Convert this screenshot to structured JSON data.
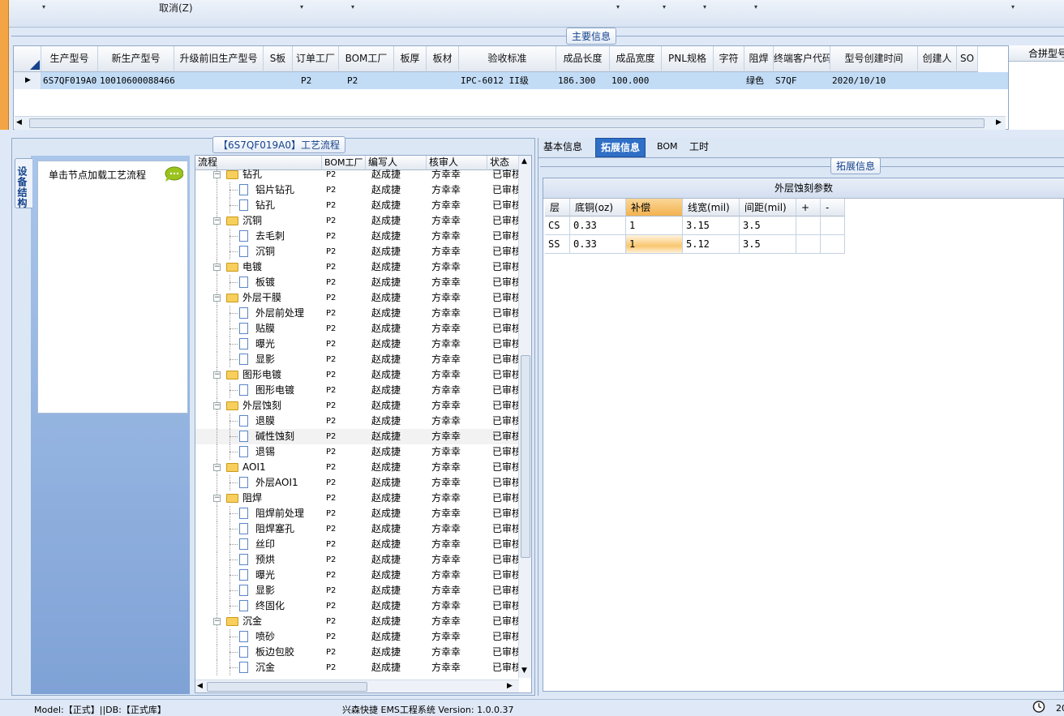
{
  "toolbar": {
    "cancel_label": "取消(Z)",
    "dropdown_glyph": "▾"
  },
  "main_group": {
    "title": "主要信息",
    "columns": [
      "生产型号",
      "新生产型号",
      "升级前旧生产型号",
      "S板",
      "订单工厂",
      "BOM工厂",
      "板厚",
      "板材",
      "验收标准",
      "成品长度",
      "成品宽度",
      "PNL规格",
      "字符",
      "阻焊",
      "终端客户代码",
      "型号创建时间",
      "创建人",
      "SO"
    ],
    "row": {
      "indicator": "▶",
      "cells": [
        "6S7QF019A0",
        "10010600088466",
        "",
        "",
        "P2",
        "P2",
        "",
        "",
        "IPC-6012 II级",
        "186.300",
        "100.000",
        "",
        "",
        "绿色",
        "S7QF",
        "2020/10/10",
        "",
        ""
      ]
    },
    "merge_panel_title": "合拼型号"
  },
  "process_group": {
    "title": "【6S7QF019A0】工艺流程"
  },
  "side_tab": {
    "label": "设备结构"
  },
  "hint_text": "单击节点加载工艺流程",
  "tree": {
    "headers": [
      "流程",
      "BOM工厂",
      "编写人",
      "核审人",
      "状态"
    ],
    "rows": [
      {
        "name": "钻孔",
        "type": "folder",
        "bom": "P2",
        "writer": "赵成捷",
        "reviewer": "方幸幸",
        "status": "已审核"
      },
      {
        "name": "铝片钻孔",
        "type": "doc",
        "bom": "P2",
        "writer": "赵成捷",
        "reviewer": "方幸幸",
        "status": "已审核"
      },
      {
        "name": "钻孔",
        "type": "doc",
        "bom": "P2",
        "writer": "赵成捷",
        "reviewer": "方幸幸",
        "status": "已审核"
      },
      {
        "name": "沉铜",
        "type": "folder",
        "bom": "P2",
        "writer": "赵成捷",
        "reviewer": "方幸幸",
        "status": "已审核"
      },
      {
        "name": "去毛刺",
        "type": "doc",
        "bom": "P2",
        "writer": "赵成捷",
        "reviewer": "方幸幸",
        "status": "已审核"
      },
      {
        "name": "沉铜",
        "type": "doc",
        "bom": "P2",
        "writer": "赵成捷",
        "reviewer": "方幸幸",
        "status": "已审核"
      },
      {
        "name": "电镀",
        "type": "folder",
        "bom": "P2",
        "writer": "赵成捷",
        "reviewer": "方幸幸",
        "status": "已审核"
      },
      {
        "name": "板镀",
        "type": "doc",
        "bom": "P2",
        "writer": "赵成捷",
        "reviewer": "方幸幸",
        "status": "已审核"
      },
      {
        "name": "外层干膜",
        "type": "folder",
        "bom": "P2",
        "writer": "赵成捷",
        "reviewer": "方幸幸",
        "status": "已审核"
      },
      {
        "name": "外层前处理",
        "type": "doc",
        "bom": "P2",
        "writer": "赵成捷",
        "reviewer": "方幸幸",
        "status": "已审核"
      },
      {
        "name": "贴膜",
        "type": "doc",
        "bom": "P2",
        "writer": "赵成捷",
        "reviewer": "方幸幸",
        "status": "已审核"
      },
      {
        "name": "曝光",
        "type": "doc",
        "bom": "P2",
        "writer": "赵成捷",
        "reviewer": "方幸幸",
        "status": "已审核"
      },
      {
        "name": "显影",
        "type": "doc",
        "bom": "P2",
        "writer": "赵成捷",
        "reviewer": "方幸幸",
        "status": "已审核"
      },
      {
        "name": "图形电镀",
        "type": "folder",
        "bom": "P2",
        "writer": "赵成捷",
        "reviewer": "方幸幸",
        "status": "已审核"
      },
      {
        "name": "图形电镀",
        "type": "doc",
        "bom": "P2",
        "writer": "赵成捷",
        "reviewer": "方幸幸",
        "status": "已审核"
      },
      {
        "name": "外层蚀刻",
        "type": "folder",
        "bom": "P2",
        "writer": "赵成捷",
        "reviewer": "方幸幸",
        "status": "已审核"
      },
      {
        "name": "退膜",
        "type": "doc",
        "bom": "P2",
        "writer": "赵成捷",
        "reviewer": "方幸幸",
        "status": "已审核"
      },
      {
        "name": "碱性蚀刻",
        "type": "doc",
        "bom": "P2",
        "writer": "赵成捷",
        "reviewer": "方幸幸",
        "status": "已审核",
        "selected": true
      },
      {
        "name": "退锡",
        "type": "doc",
        "bom": "P2",
        "writer": "赵成捷",
        "reviewer": "方幸幸",
        "status": "已审核"
      },
      {
        "name": "AOI1",
        "type": "folder",
        "bom": "P2",
        "writer": "赵成捷",
        "reviewer": "方幸幸",
        "status": "已审核"
      },
      {
        "name": "外层AOI1",
        "type": "doc",
        "bom": "P2",
        "writer": "赵成捷",
        "reviewer": "方幸幸",
        "status": "已审核"
      },
      {
        "name": "阻焊",
        "type": "folder",
        "bom": "P2",
        "writer": "赵成捷",
        "reviewer": "方幸幸",
        "status": "已审核"
      },
      {
        "name": "阻焊前处理",
        "type": "doc",
        "bom": "P2",
        "writer": "赵成捷",
        "reviewer": "方幸幸",
        "status": "已审核"
      },
      {
        "name": "阻焊塞孔",
        "type": "doc",
        "bom": "P2",
        "writer": "赵成捷",
        "reviewer": "方幸幸",
        "status": "已审核"
      },
      {
        "name": "丝印",
        "type": "doc",
        "bom": "P2",
        "writer": "赵成捷",
        "reviewer": "方幸幸",
        "status": "已审核"
      },
      {
        "name": "预烘",
        "type": "doc",
        "bom": "P2",
        "writer": "赵成捷",
        "reviewer": "方幸幸",
        "status": "已审核"
      },
      {
        "name": "曝光",
        "type": "doc",
        "bom": "P2",
        "writer": "赵成捷",
        "reviewer": "方幸幸",
        "status": "已审核"
      },
      {
        "name": "显影",
        "type": "doc",
        "bom": "P2",
        "writer": "赵成捷",
        "reviewer": "方幸幸",
        "status": "已审核"
      },
      {
        "name": "终固化",
        "type": "doc",
        "bom": "P2",
        "writer": "赵成捷",
        "reviewer": "方幸幸",
        "status": "已审核"
      },
      {
        "name": "沉金",
        "type": "folder",
        "bom": "P2",
        "writer": "赵成捷",
        "reviewer": "方幸幸",
        "status": "已审核"
      },
      {
        "name": "喷砂",
        "type": "doc",
        "bom": "P2",
        "writer": "赵成捷",
        "reviewer": "方幸幸",
        "status": "已审核"
      },
      {
        "name": "板边包胶",
        "type": "doc",
        "bom": "P2",
        "writer": "赵成捷",
        "reviewer": "方幸幸",
        "status": "已审核"
      },
      {
        "name": "沉金",
        "type": "doc",
        "bom": "P2",
        "writer": "赵成捷",
        "reviewer": "方幸幸",
        "status": "已审核"
      }
    ]
  },
  "right_tabs": [
    "基本信息",
    "拓展信息",
    "BOM",
    "工时"
  ],
  "ext_group": {
    "title": "拓展信息"
  },
  "etch_params": {
    "title": "外层蚀刻参数",
    "headers": [
      "层",
      "底铜(oz)",
      "补偿",
      "线宽(mil)",
      "间距(mil)",
      "+",
      "-"
    ],
    "rows": [
      [
        "CS",
        "0.33",
        "1",
        "3.15",
        "3.5",
        "",
        ""
      ],
      [
        "SS",
        "0.33",
        "1",
        "5.12",
        "3.5",
        "",
        ""
      ]
    ]
  },
  "status_bar": {
    "left": "Model:【正式】||DB:【正式库】",
    "center": "兴森快捷 EMS工程系统 Version: 1.0.0.37",
    "right": "20"
  },
  "colors": {
    "accent": "#2f6fc6",
    "selected_row": "#c2dcf6",
    "highlight_col": "#f9c770",
    "orange_bar": "#f3a545"
  }
}
